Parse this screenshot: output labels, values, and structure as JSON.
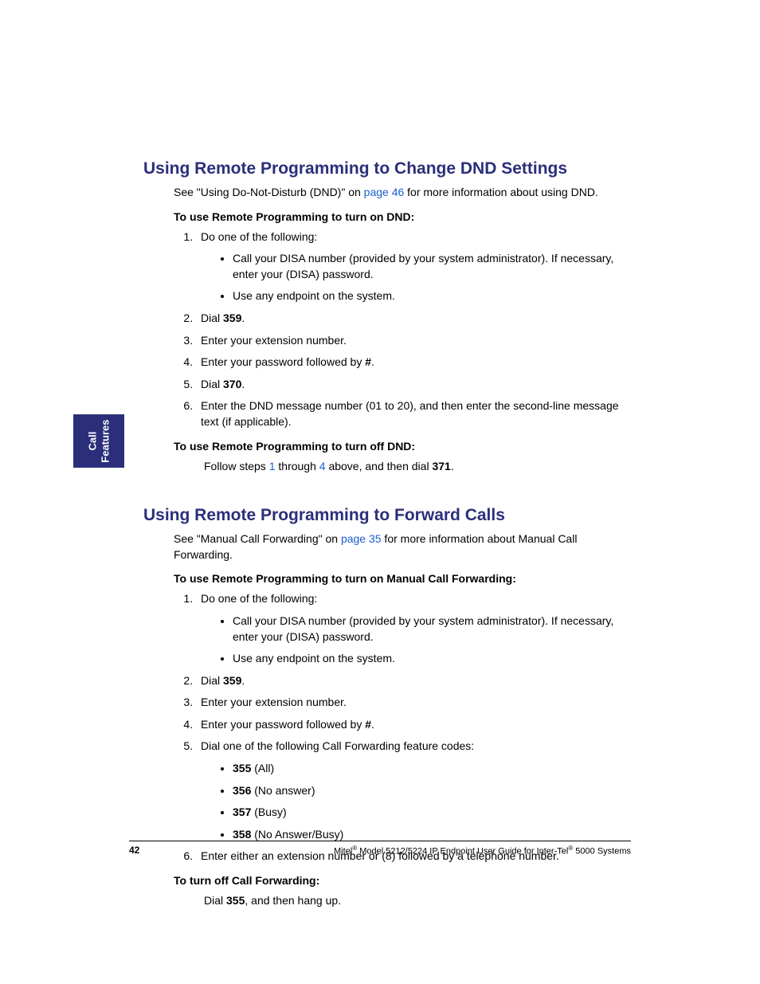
{
  "sideTab": {
    "line1": "Call",
    "line2": "Features"
  },
  "h1": "Using Remote Programming to Change DND Settings",
  "intro1a": "See \"Using Do-Not-Disturb (DND)\" on ",
  "intro1link": "page 46",
  "intro1b": " for more information about using DND.",
  "sub1": "To use Remote Programming to turn on DND:",
  "s1_1": "Do one of the following:",
  "s1_1_b1": "Call your DISA number (provided by your system administrator). If necessary, enter your (DISA) password.",
  "s1_1_b2": "Use any endpoint on the system.",
  "s1_2a": "Dial ",
  "s1_2b": "359",
  "s1_2c": ".",
  "s1_3": "Enter your extension number.",
  "s1_4a": "Enter your password followed by ",
  "s1_4b": "#",
  "s1_4c": ".",
  "s1_5a": "Dial ",
  "s1_5b": "370",
  "s1_5c": ".",
  "s1_6": "Enter the DND message number (01 to 20), and then enter the second-line message text (if applicable).",
  "sub2": "To use Remote Programming to turn off DND:",
  "follow_a": "Follow steps ",
  "follow_1": "1",
  "follow_b": " through ",
  "follow_4": "4",
  "follow_c": " above, and then dial ",
  "follow_d": "371",
  "follow_e": ".",
  "h2": "Using Remote Programming to Forward Calls",
  "intro2a": "See \"Manual Call Forwarding\" on ",
  "intro2link": "page 35",
  "intro2b": " for more information about Manual Call Forwarding.",
  "sub3": "To use Remote Programming to turn on Manual Call Forwarding:",
  "s3_1": "Do one of the following:",
  "s3_1_b1": "Call your DISA number (provided by your system administrator). If necessary, enter your (DISA) password.",
  "s3_1_b2": "Use any endpoint on the system.",
  "s3_2a": "Dial ",
  "s3_2b": "359",
  "s3_2c": ".",
  "s3_3": "Enter your extension number.",
  "s3_4a": "Enter your password followed by ",
  "s3_4b": "#",
  "s3_4c": ".",
  "s3_5": "Dial one of the following Call Forwarding feature codes:",
  "s3_5_c1a": "355",
  "s3_5_c1b": " (All)",
  "s3_5_c2a": "356",
  "s3_5_c2b": " (No answer)",
  "s3_5_c3a": "357",
  "s3_5_c3b": " (Busy)",
  "s3_5_c4a": "358",
  "s3_5_c4b": " (No Answer/Busy)",
  "s3_6": "Enter either an extension number or (8) followed by a telephone number.",
  "sub4": "To turn off Call Forwarding:",
  "off_a": "Dial ",
  "off_b": "355",
  "off_c": ", and then hang up.",
  "pageNum": "42",
  "footerText": "Mitel® Model 5212/5224 IP Endpoint User Guide for Inter-Tel® 5000 Systems"
}
